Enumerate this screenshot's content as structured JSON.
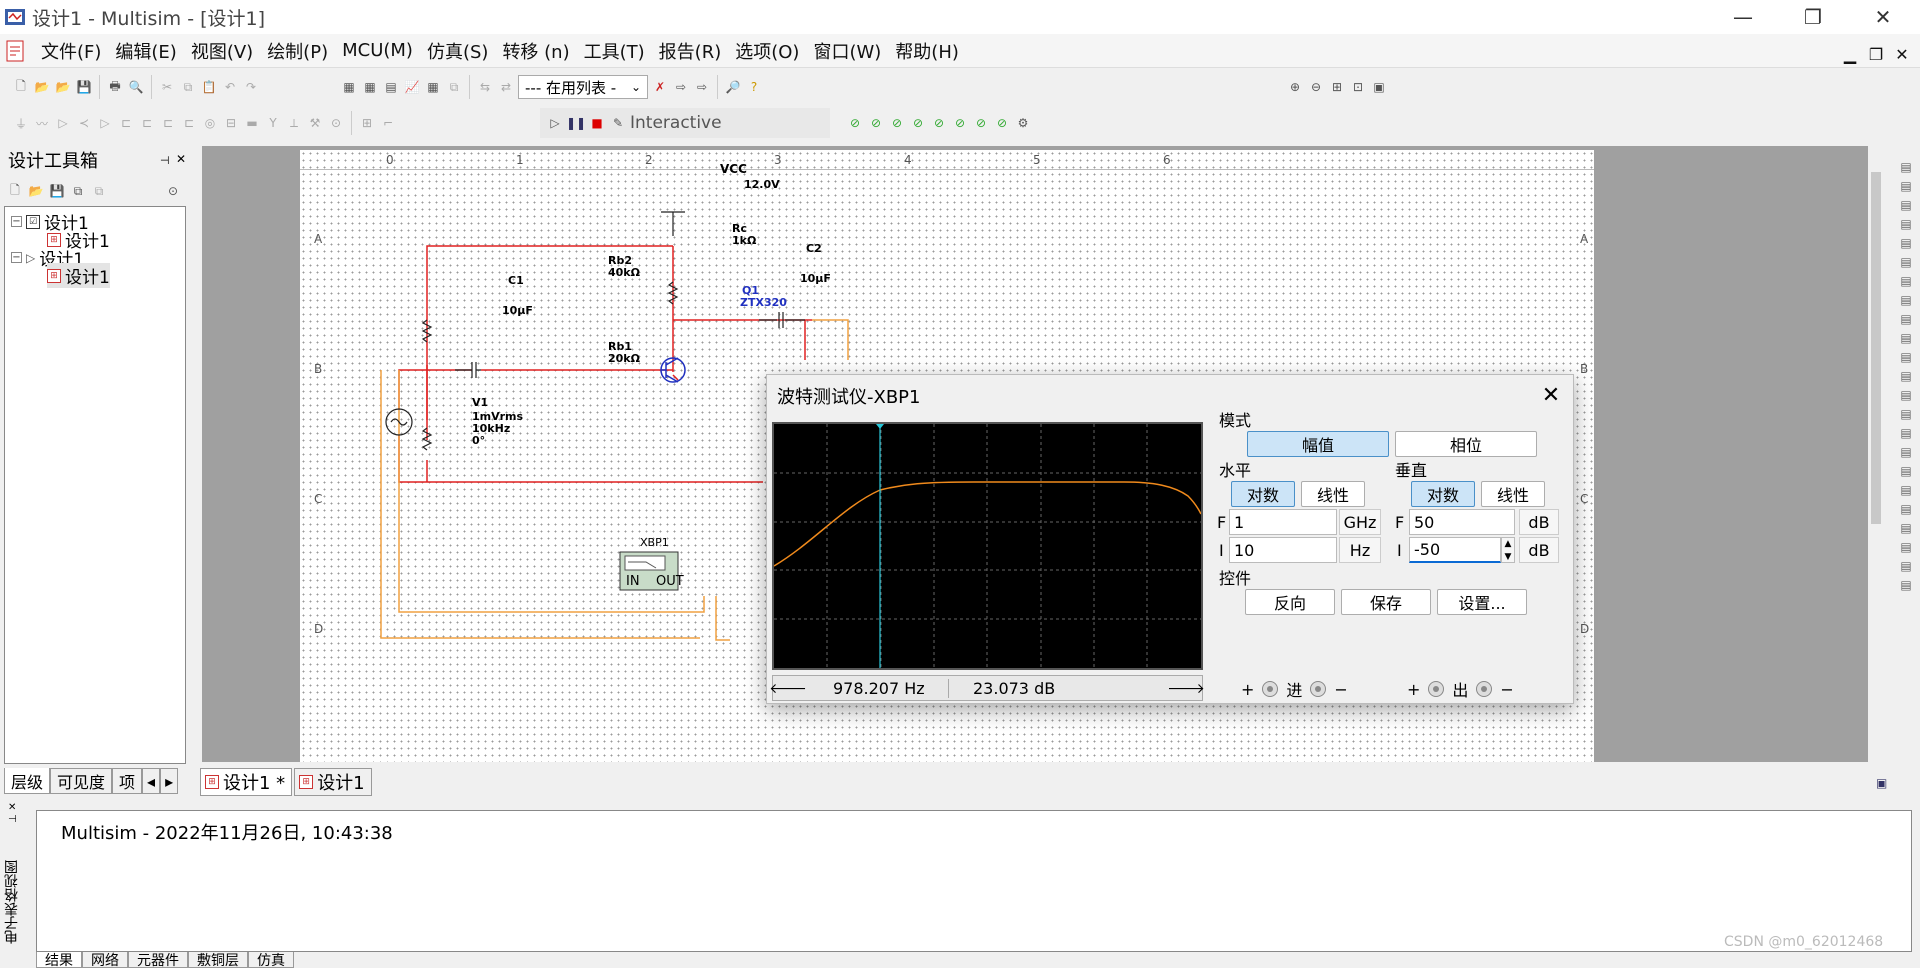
{
  "window": {
    "title": "设计1 - Multisim - [设计1]"
  },
  "menu": [
    "文件(F)",
    "编辑(E)",
    "视图(V)",
    "绘制(P)",
    "MCU(M)",
    "仿真(S)",
    "转移 (n)",
    "工具(T)",
    "报告(R)",
    "选项(O)",
    "窗口(W)",
    "帮助(H)"
  ],
  "toolbar": {
    "inuse_list": "--- 在用列表 -",
    "interactive": "Interactive"
  },
  "design_toolbox": {
    "title": "设计工具箱",
    "tree": [
      "设计1",
      "设计1",
      "设计1",
      "设计1"
    ],
    "tabs": [
      "层级",
      "可见度",
      "项"
    ]
  },
  "doc_tabs": [
    "设计1 *",
    "设计1"
  ],
  "ruler": {
    "cols": [
      "0",
      "1",
      "2",
      "3",
      "4",
      "5",
      "6"
    ],
    "rows": [
      "A",
      "B",
      "C",
      "D"
    ]
  },
  "schematic": {
    "vcc": "VCC",
    "vcc_val": "12.0V",
    "rc": "Rc",
    "rc_val": "1kΩ",
    "c2": "C2",
    "c2_val": "10µF",
    "rb2": "Rb2",
    "rb2_val": "40kΩ",
    "c1": "C1",
    "c1_val": "10µF",
    "q1": "Q1",
    "q1_val": "ZTX320",
    "rb1": "Rb1",
    "rb1_val": "20kΩ",
    "v1": "V1",
    "v1_l1": "1mVrms",
    "v1_l2": "10kHz",
    "v1_l3": "0°",
    "xbp1": "XBP1",
    "xbp_in": "IN",
    "xbp_out": "OUT"
  },
  "spreadsheet": {
    "message": "Multisim  -  2022年11月26日, 10:43:38",
    "side_label": "电子表格视图",
    "tabs": [
      "结果",
      "网络",
      "元器件",
      "敷铜层",
      "仿真"
    ]
  },
  "watermark": "CSDN @m0_62012468",
  "bode": {
    "title": "波特测试仪-XBP1",
    "mode_label": "模式",
    "mode_buttons": [
      "幅值",
      "相位"
    ],
    "horizontal_label": "水平",
    "vertical_label": "垂直",
    "log": "对数",
    "linear": "线性",
    "h_F_value": "1",
    "h_F_unit": "GHz",
    "h_I_value": "10",
    "h_I_unit": "Hz",
    "v_F_value": "50",
    "v_F_unit": "dB",
    "v_I_value": "-50",
    "v_I_unit": "dB",
    "F": "F",
    "I": "I",
    "controls_label": "控件",
    "control_buttons": [
      "反向",
      "保存",
      "设置..."
    ],
    "cursor_freq": "978.207  Hz",
    "cursor_gain": "23.073 dB",
    "in_label": "进",
    "out_label": "出",
    "plus": "+",
    "minus": "−"
  },
  "colors": {
    "accent_sel": "#cce4f7",
    "wire_red": "#e02020",
    "wire_orange": "#f0a040",
    "trace": "#f08a1c",
    "cursor": "#27c6d8"
  }
}
